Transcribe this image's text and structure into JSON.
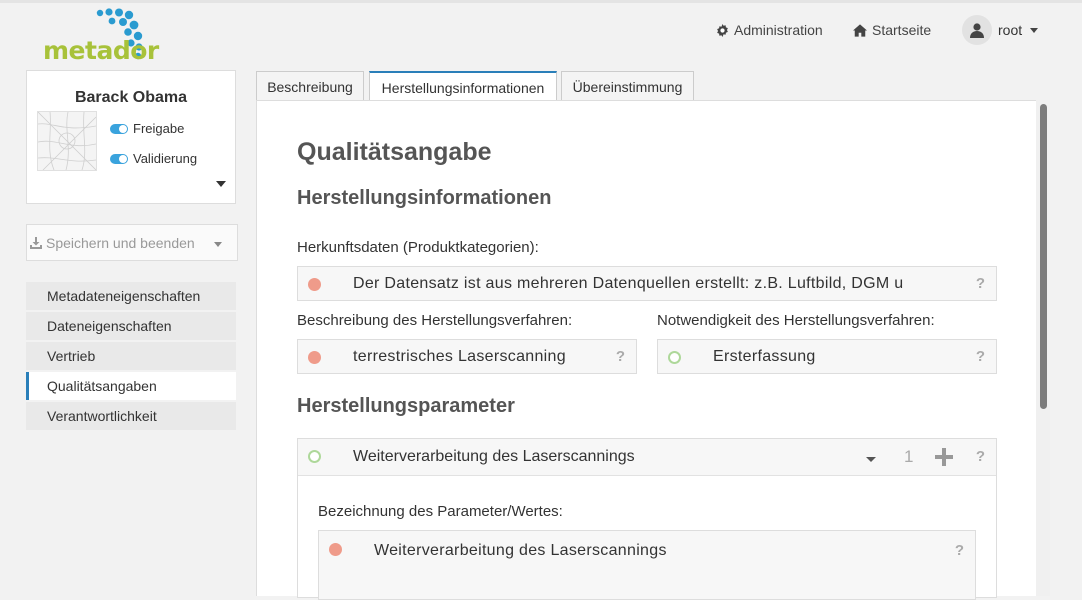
{
  "header": {
    "logo_text": "metador",
    "nav_admin": "Administration",
    "nav_home": "Startseite",
    "user": "root"
  },
  "profile": {
    "name": "Barack Obama",
    "toggle_release": "Freigabe",
    "toggle_validation": "Validierung"
  },
  "save_button": "Speichern und beenden",
  "menu": [
    {
      "label": "Metadateneigenschaften",
      "active": false
    },
    {
      "label": "Dateneigenschaften",
      "active": false
    },
    {
      "label": "Vertrieb",
      "active": false
    },
    {
      "label": "Qualitätsangaben",
      "active": true
    },
    {
      "label": "Verantwortlichkeit",
      "active": false
    }
  ],
  "tabs": [
    {
      "label": "Beschreibung",
      "active": false
    },
    {
      "label": "Herstellungsinformationen",
      "active": true
    },
    {
      "label": "Übereinstimmung",
      "active": false
    }
  ],
  "content": {
    "title": "Qualitätsangabe",
    "section1_title": "Herstellungsinformationen",
    "origin_label": "Herkunftsdaten (Produktkategorien):",
    "origin_value": "Der Datensatz ist aus mehreren Datenquellen erstellt: z.B. Luftbild, DGM u",
    "process_desc_label": "Beschreibung des Herstellungsverfahren:",
    "process_desc_value": "terrestrisches Laserscanning",
    "process_need_label": "Notwendigkeit des Herstellungsverfahren:",
    "process_need_value": "Ersterfassung",
    "section2_title": "Herstellungsparameter",
    "param_header": "Weiterverarbeitung des Laserscannings",
    "param_count": "1",
    "param_name_label": "Bezeichnung des Parameter/Wertes:",
    "param_name_value": "Weiterverarbeitung des Laserscannings",
    "help": "?"
  },
  "colors": {
    "accent": "#2a7fb9",
    "logo_green": "#a8c23a",
    "logo_blue": "#2a9bd0",
    "required_dot": "#ef9b8a",
    "optional_dot": "#aed89a"
  },
  "icons": {
    "admin": "gear-icon",
    "home": "home-icon",
    "user": "user-icon",
    "save": "save-icon"
  }
}
